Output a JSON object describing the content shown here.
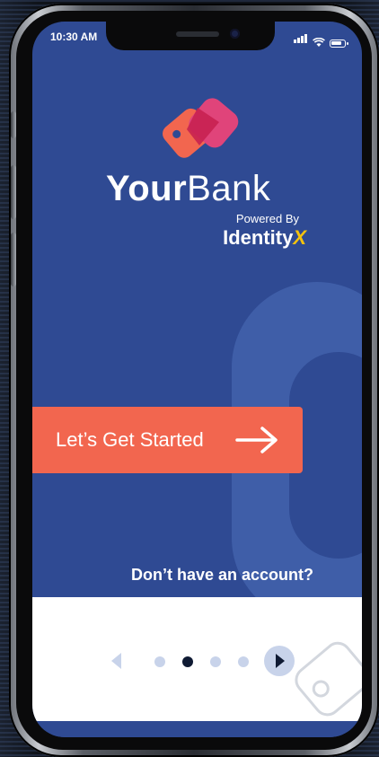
{
  "status_bar": {
    "time": "10:30 AM",
    "icons": [
      "signal-icon",
      "wifi-icon",
      "battery-icon"
    ]
  },
  "brand": {
    "name_bold": "Your",
    "name_light": "Bank",
    "powered_by": "Powered By",
    "partner_name": "Identity",
    "partner_mark": "X",
    "logo_icon": "heart-tag-logo-icon"
  },
  "cta": {
    "label": "Let’s Get Started",
    "icon": "arrow-right-icon"
  },
  "account_prompt": "Don’t have an account?",
  "pager": {
    "total": 4,
    "active_index": 1,
    "prev_icon": "chevron-left-icon",
    "next_icon": "chevron-right-icon"
  },
  "colors": {
    "primary_blue": "#2f4a93",
    "accent_coral": "#f2664f",
    "logo_pink": "#e0447a",
    "identityx_yellow": "#f4c20d"
  }
}
